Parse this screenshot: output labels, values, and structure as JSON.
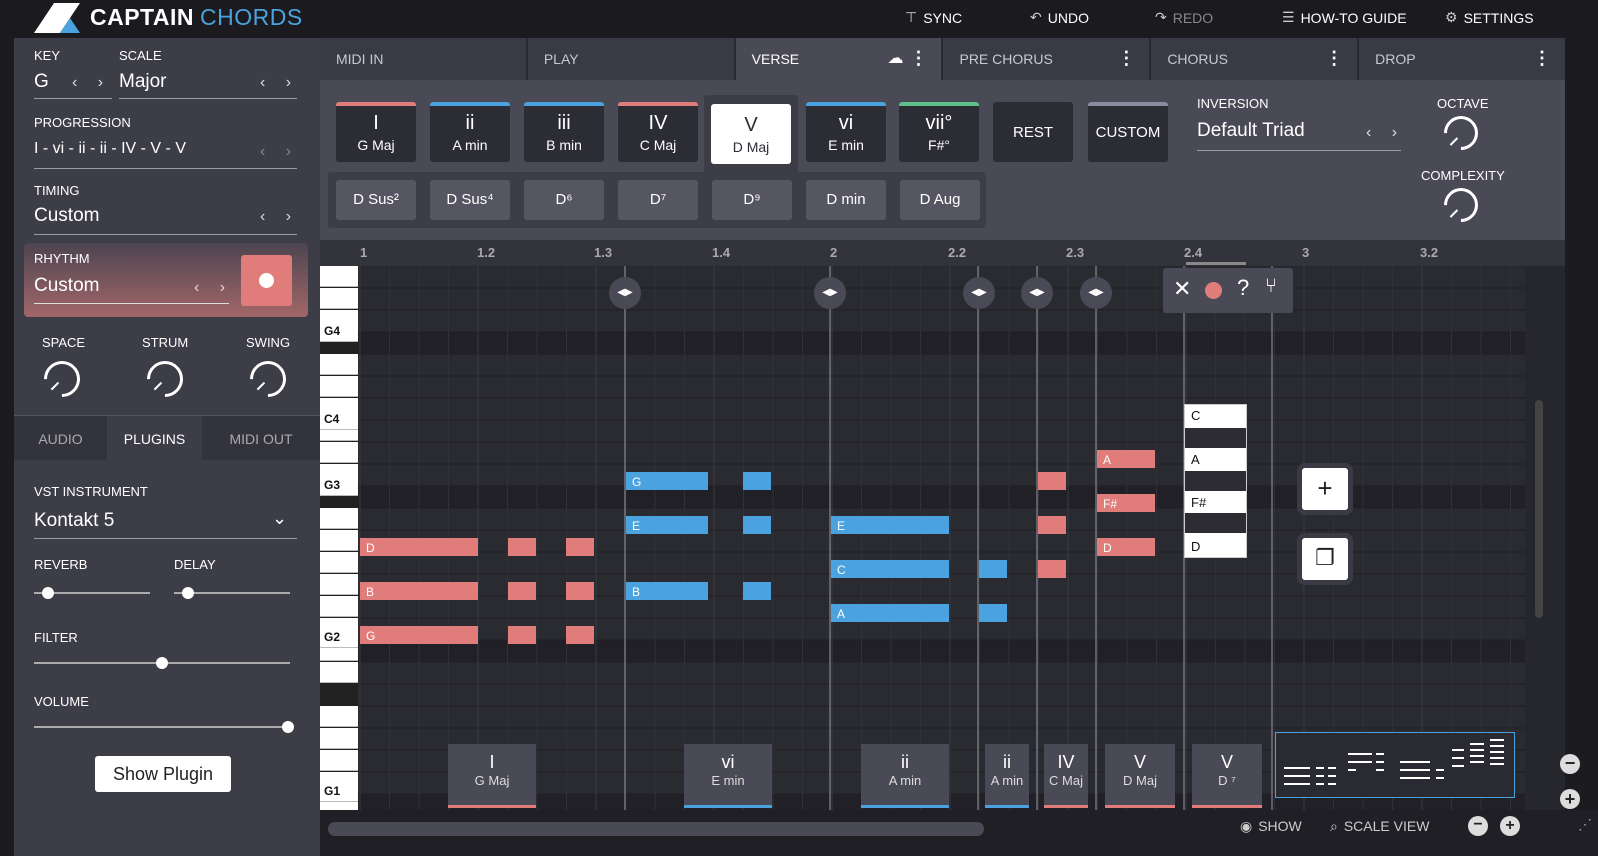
{
  "app": {
    "brand_a": "CAPTAIN",
    "brand_b": "CHORDS"
  },
  "topbar": {
    "sync": "SYNC",
    "undo": "UNDO",
    "redo": "REDO",
    "guide": "HOW-TO GUIDE",
    "settings": "SETTINGS"
  },
  "left": {
    "key_label": "KEY",
    "key_value": "G",
    "scale_label": "SCALE",
    "scale_value": "Major",
    "progression_label": "PROGRESSION",
    "progression_value": "I - vi - ii - ii - IV - V - V",
    "timing_label": "TIMING",
    "timing_value": "Custom",
    "rhythm_label": "RHYTHM",
    "rhythm_value": "Custom",
    "space": "SPACE",
    "strum": "STRUM",
    "swing": "SWING",
    "tabs": [
      "AUDIO",
      "PLUGINS",
      "MIDI OUT"
    ],
    "vst_label": "VST INSTRUMENT",
    "vst_value": "Kontakt 5",
    "reverb": "REVERB",
    "delay": "DELAY",
    "filter": "FILTER",
    "volume": "VOLUME",
    "show_plugin": "Show Plugin",
    "reverb_level": 0.1,
    "delay_level": 0.1,
    "filter_level": 0.5,
    "volume_level": 1.0
  },
  "sections": {
    "tabs": [
      "MIDI IN",
      "PLAY",
      "VERSE",
      "PRE CHORUS",
      "CHORUS",
      "DROP"
    ]
  },
  "chords": [
    {
      "rn": "I",
      "name": "G Maj",
      "color": "#e07d7b"
    },
    {
      "rn": "ii",
      "name": "A min",
      "color": "#4aa3df"
    },
    {
      "rn": "iii",
      "name": "B min",
      "color": "#4aa3df"
    },
    {
      "rn": "IV",
      "name": "C Maj",
      "color": "#e07d7b"
    },
    {
      "rn": "V",
      "name": "D Maj",
      "color": "#e07d7b"
    },
    {
      "rn": "vi",
      "name": "E min",
      "color": "#4aa3df"
    },
    {
      "rn": "vii°",
      "name": "F#°",
      "color": "#5cc08a"
    }
  ],
  "rest": "REST",
  "custom": "CUSTOM",
  "variations": [
    "D Sus²",
    "D Sus⁴",
    "D⁶",
    "D⁷",
    "D⁹",
    "D min",
    "D Aug"
  ],
  "inversion_label": "INVERSION",
  "inversion_value": "Default Triad",
  "octave_label": "OCTAVE",
  "complexity_label": "COMPLEXITY",
  "ruler": [
    "1",
    "1.2",
    "1.3",
    "1.4",
    "2",
    "2.2",
    "2.3",
    "2.4",
    "3",
    "3.2"
  ],
  "keys": [
    "G4",
    "C4",
    "G3",
    "G2",
    "G1"
  ],
  "note_labels": {
    "D": "D",
    "B": "B",
    "G": "G",
    "E": "E",
    "C": "C",
    "A": "A",
    "Fs": "F#"
  },
  "popup_notes": [
    "C",
    "A",
    "F#",
    "D"
  ],
  "chord_track": [
    {
      "rn": "I",
      "name": "G Maj",
      "color": "#e07d7b"
    },
    {
      "rn": "vi",
      "name": "E min",
      "color": "#4aa3df"
    },
    {
      "rn": "ii",
      "name": "A min",
      "color": "#4aa3df"
    },
    {
      "rn": "ii",
      "name": "A min",
      "color": "#4aa3df"
    },
    {
      "rn": "IV",
      "name": "C Maj",
      "color": "#e07d7b"
    },
    {
      "rn": "V",
      "name": "D Maj",
      "color": "#e07d7b"
    },
    {
      "rn": "V",
      "name": "D ⁷",
      "color": "#e07d7b"
    }
  ],
  "bottom": {
    "show": "SHOW",
    "scale_view": "SCALE VIEW"
  }
}
